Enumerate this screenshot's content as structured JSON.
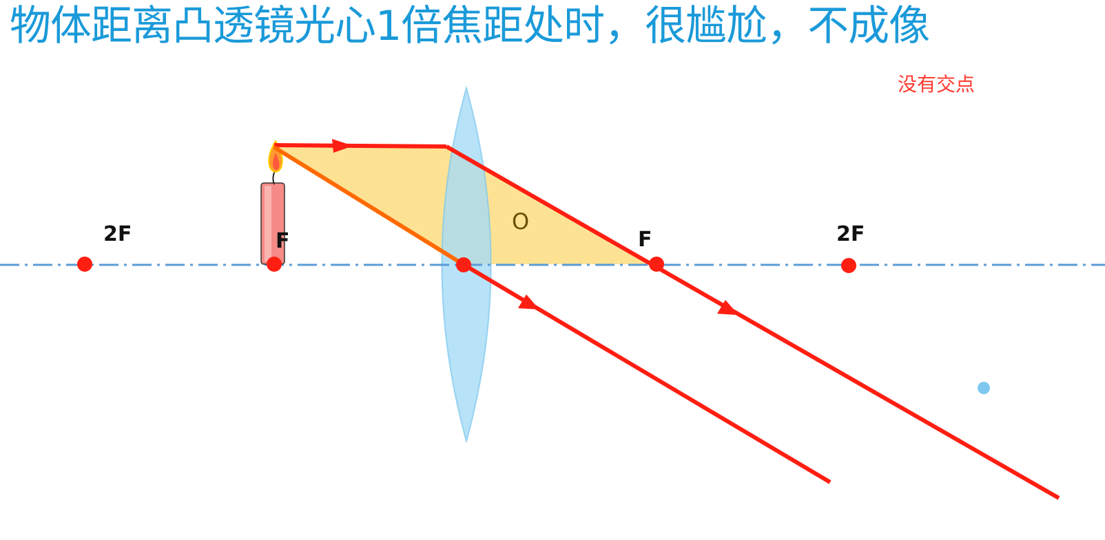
{
  "title": "物体距离凸透镜光心1倍焦距处时，很尴尬，不成像",
  "note": "没有交点",
  "labels": {
    "left_2f": "2F",
    "left_f": "F",
    "center": "O",
    "right_f": "F",
    "right_2f": "2F"
  },
  "colors": {
    "title": "#1a9ad9",
    "note": "#ff3b30",
    "ray": "#ff1e12",
    "ray_inner": "#ff6a00",
    "axis": "#5b9bd5",
    "lens_fill": "#a6dcf7",
    "lens_stroke": "#7cc8ee",
    "triangle": "#fde08e",
    "point": "#ff1e12",
    "stray_dot": "#7ec8f0",
    "label_dark": "#111111",
    "center_label": "#6b4e00"
  }
}
